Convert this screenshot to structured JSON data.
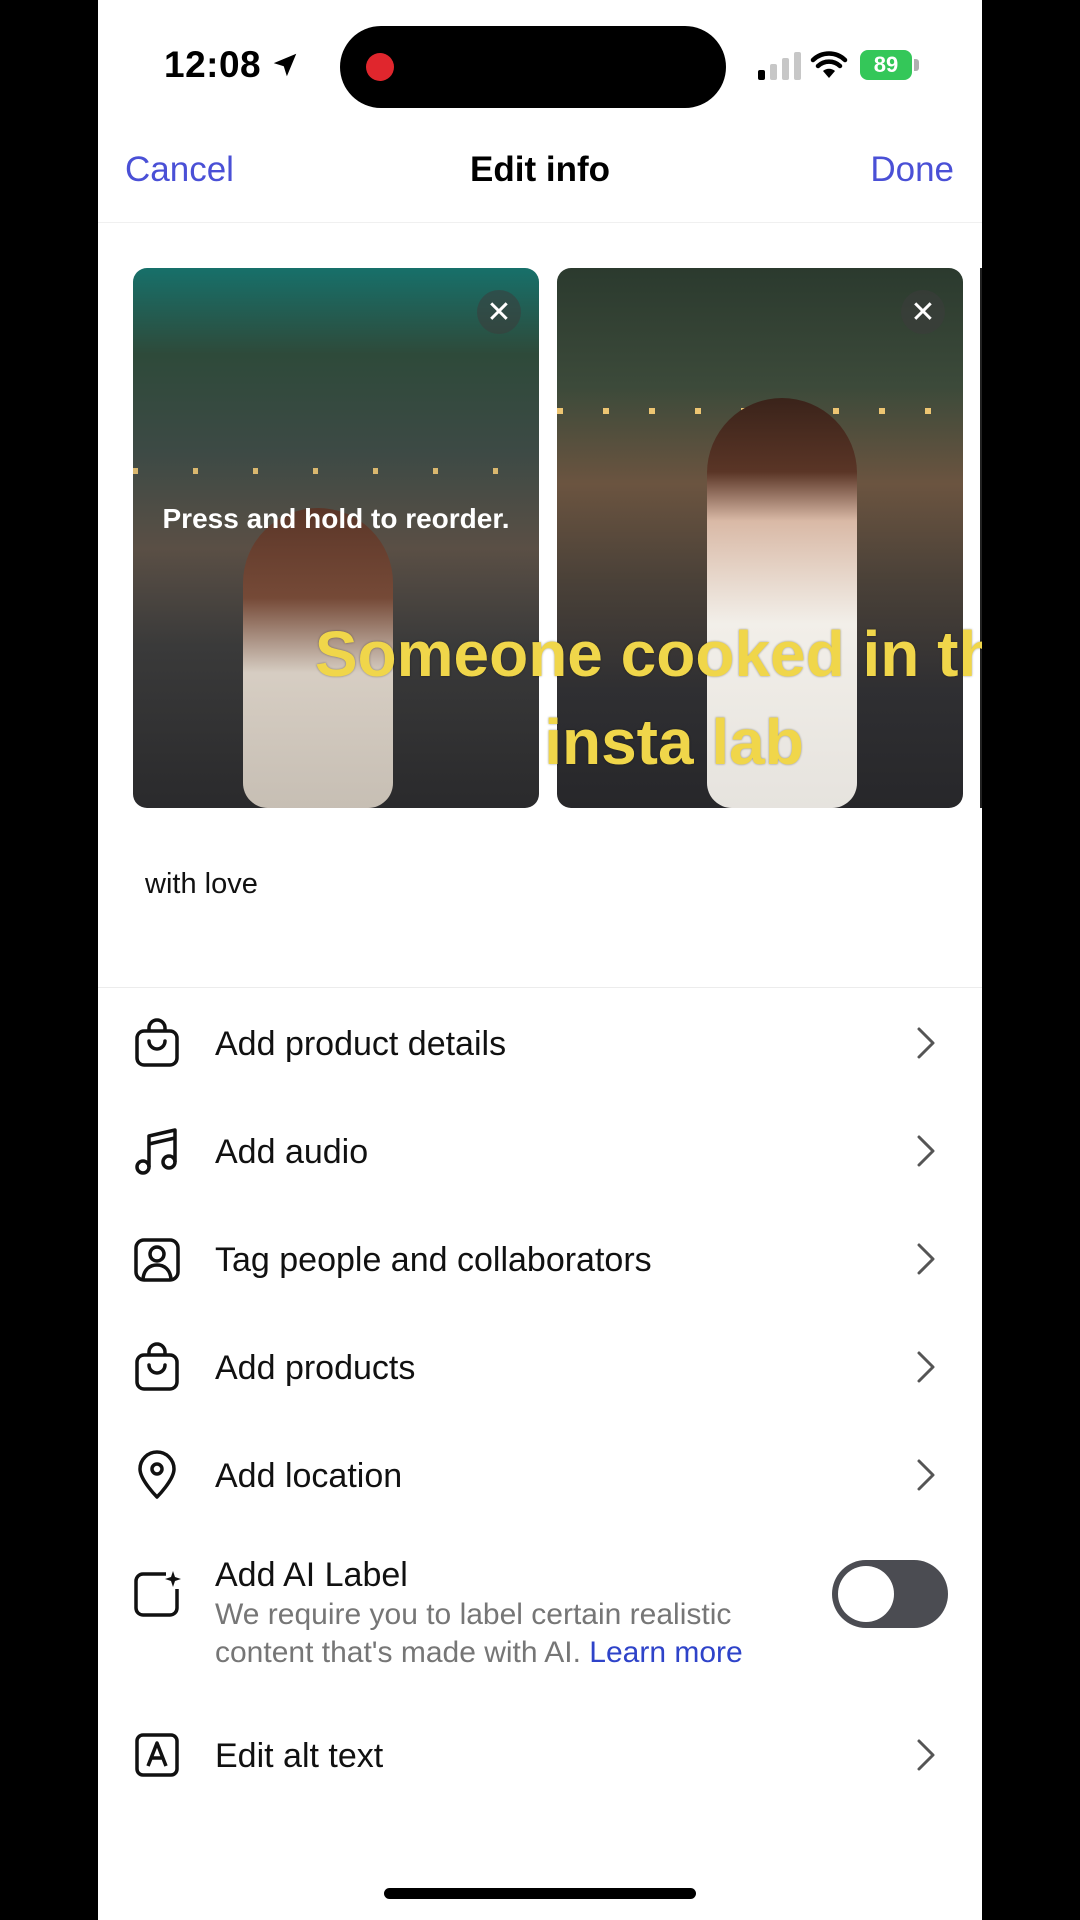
{
  "status_bar": {
    "time": "12:08",
    "battery": "89"
  },
  "header": {
    "cancel": "Cancel",
    "title": "Edit info",
    "done": "Done"
  },
  "media": {
    "reorder_hint": "Press and hold to reorder.",
    "overlay_text": "Someone cooked in the insta lab"
  },
  "caption": "with love",
  "menu": {
    "product_details": "Add product details",
    "audio": "Add audio",
    "tag_people": "Tag people and collaborators",
    "products": "Add products",
    "location": "Add location",
    "ai_label": {
      "title": "Add AI Label",
      "description": "We require you to label certain realistic content that's made with AI.",
      "link": "Learn more",
      "enabled": false
    },
    "alt_text": "Edit alt text"
  },
  "colors": {
    "accent": "#4a50d6",
    "link": "#2e43c9",
    "overlay_text": "#f0d64a",
    "battery": "#34c759"
  }
}
